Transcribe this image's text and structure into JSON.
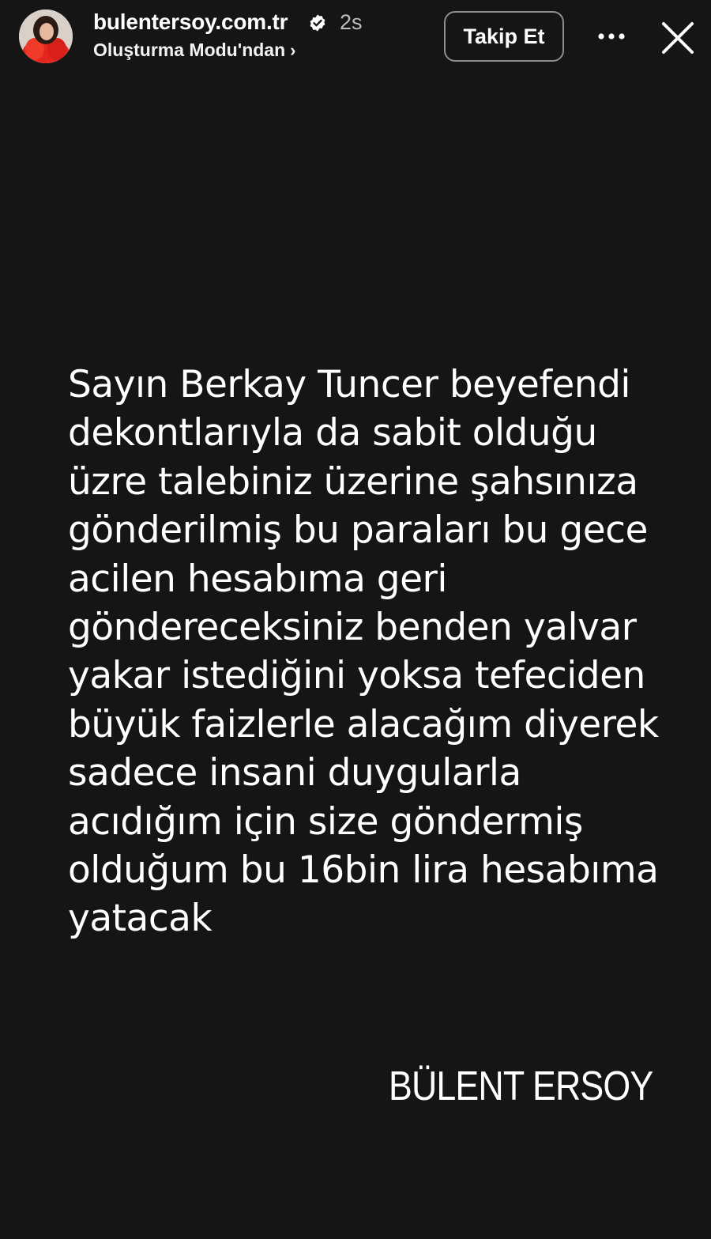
{
  "header": {
    "username": "bulentersoy.com.tr",
    "verified_icon": "verified-badge-icon",
    "timestamp": "2s",
    "subtitle": "Oluşturma Modu'ndan",
    "subtitle_chevron": "›",
    "follow_label": "Takip Et",
    "more_icon": "more-options-icon",
    "close_icon": "close-icon"
  },
  "story": {
    "message": "Sayın Berkay Tuncer beyefendi\ndekontlarıyla da sabit olduğu\nüzre talebiniz üzerine şahsınıza\ngönderilmiş bu paraları bu gece\nacilen hesabıma geri\ngöndereceksiniz benden yalvar\nyakar istediğini yoksa tefeciden\nbüyük faizlerle alacağım diyerek\nsadece insani duygularla\nacıdığım için size göndermiş\nolduğum bu 16bin lira hesabıma\nyatacak",
    "signature": "BÜLENT ERSOY"
  },
  "colors": {
    "background": "#151515",
    "text": "#ffffff",
    "secondary_text": "#bdbdbd",
    "button_border": "#8e8e8e"
  }
}
